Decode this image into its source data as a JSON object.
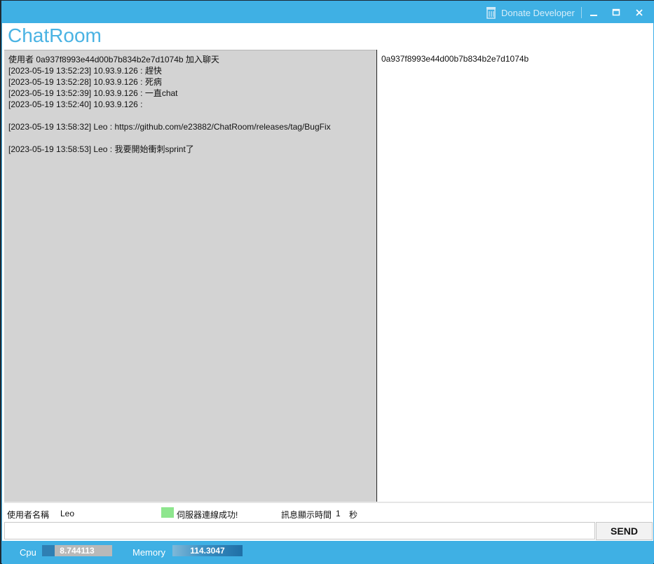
{
  "window": {
    "donate_label": "Donate Developer",
    "minimize_icon": "minimize-icon",
    "maximize_icon": "maximize-icon",
    "close_icon": "close-icon"
  },
  "app": {
    "title": "ChatRoom"
  },
  "chat": {
    "messages": [
      "使用者 0a937f8993e44d00b7b834b2e7d1074b 加入聊天",
      "[2023-05-19 13:52:23] 10.93.9.126 : 趕快",
      "[2023-05-19 13:52:28] 10.93.9.126 : 死病",
      "[2023-05-19 13:52:39] 10.93.9.126 : 一直chat",
      "[2023-05-19 13:52:40] 10.93.9.126 :",
      "",
      "[2023-05-19 13:58:32] Leo : https://github.com/e23882/ChatRoom/releases/tag/BugFix",
      "",
      "[2023-05-19 13:58:53] Leo : 我要開始衝刺sprint了"
    ]
  },
  "users": {
    "items": [
      "0a937f8993e44d00b7b834b2e7d1074b"
    ]
  },
  "info": {
    "username_label": "使用者名稱",
    "username_value": "Leo",
    "server_status": "伺服器連線成功!",
    "server_status_color": "#8ee68e",
    "display_time_label": "訊息顯示時間",
    "display_time_value": "1",
    "display_time_unit": "秒"
  },
  "input": {
    "value": "",
    "send_label": "SEND"
  },
  "status": {
    "cpu_label": "Cpu",
    "cpu_value": "8.744113",
    "memory_label": "Memory",
    "memory_value": "114.3047"
  }
}
